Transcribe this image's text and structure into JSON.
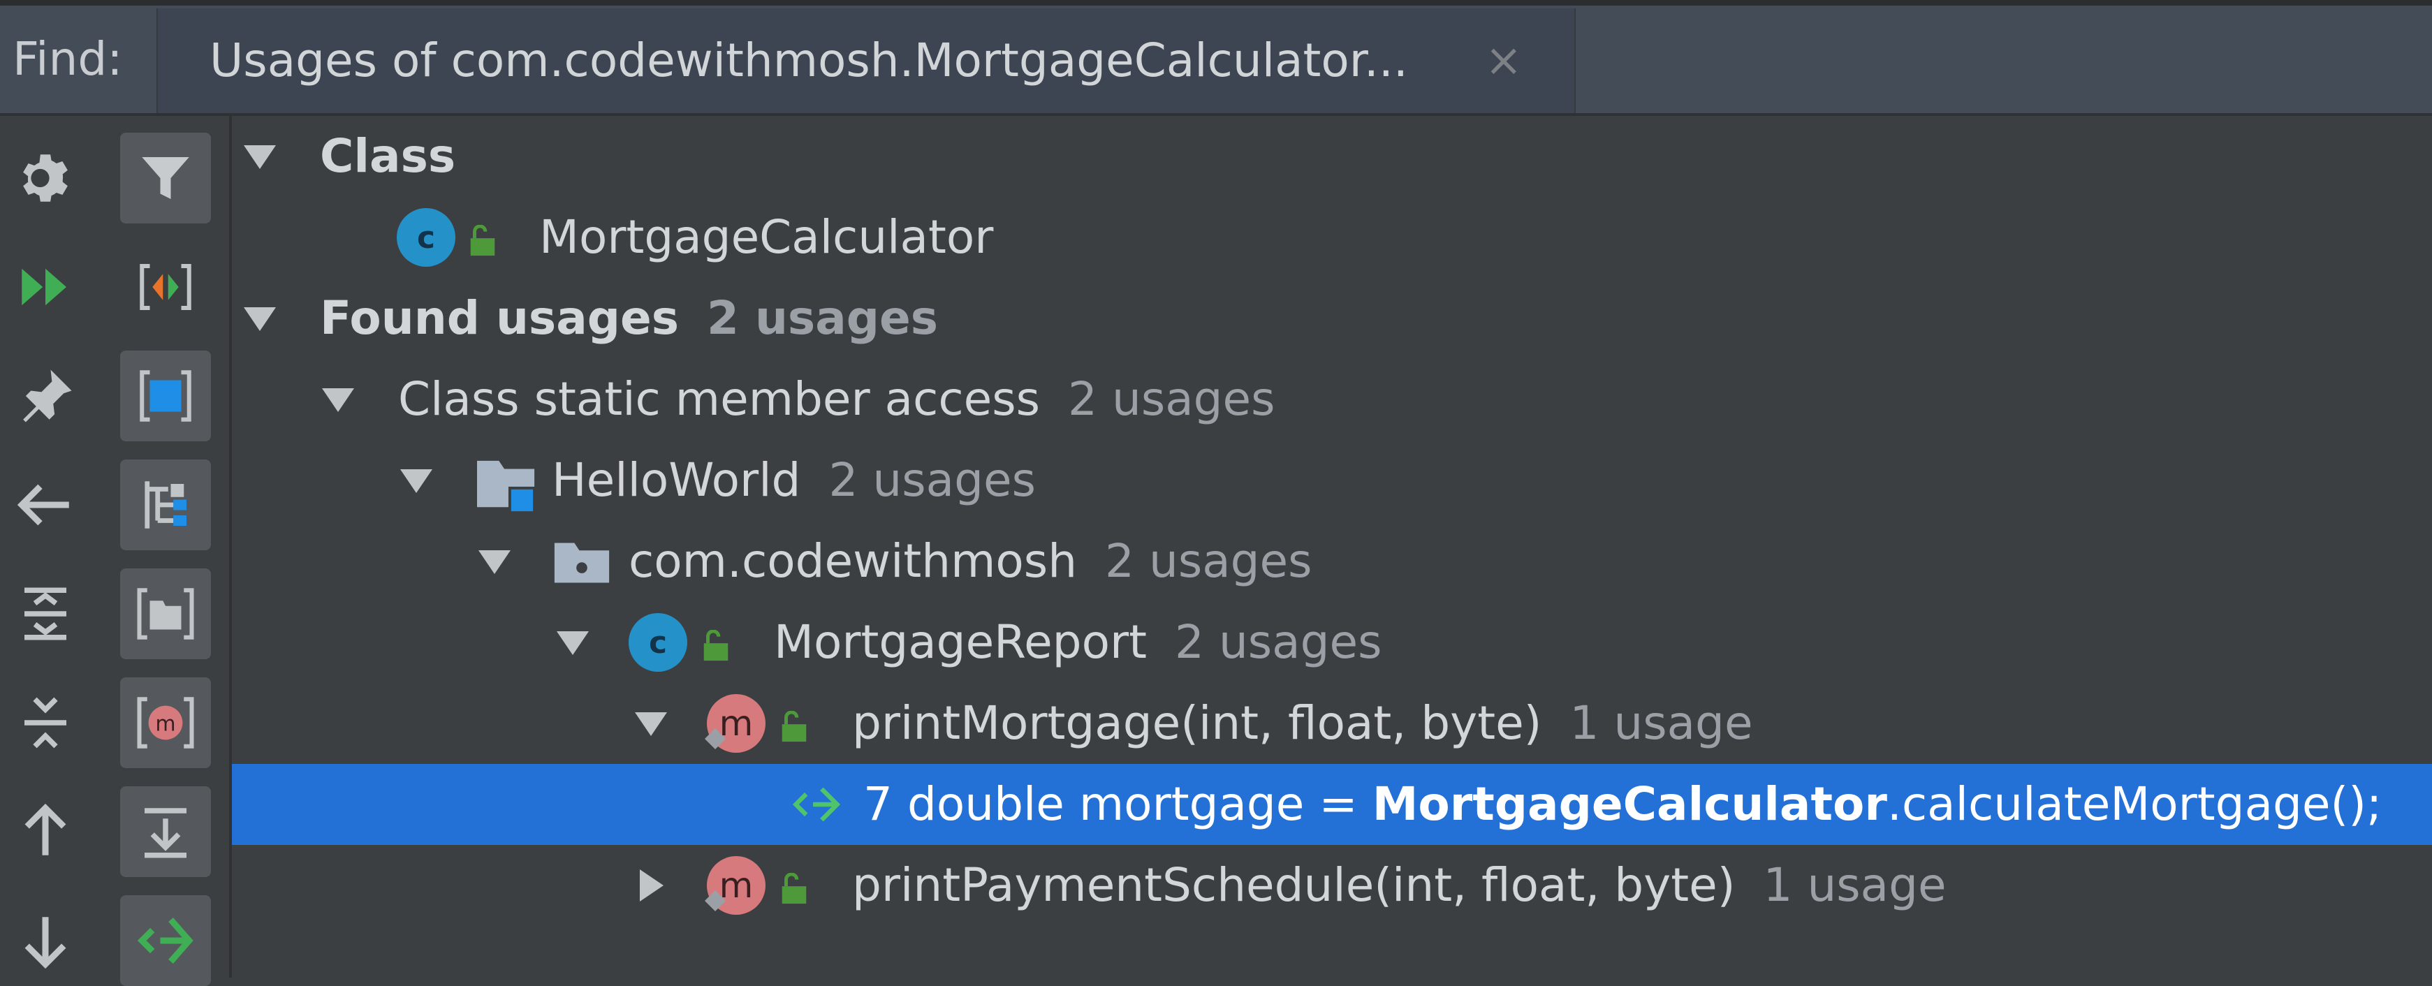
{
  "find_panel": {
    "find_label": "Find:",
    "tab_title": "Usages of com.codewithmosh.MortgageCalculator...",
    "tab_close_glyph": "×"
  },
  "toolbar": {
    "left_column": [
      "gear-icon",
      "rerun-icon",
      "pin-icon",
      "previous-occurrence-icon",
      "expand-all-icon",
      "collapse-all-icon",
      "next-icon",
      "down-icon"
    ],
    "right_column": [
      "filter-icon",
      "preview-icon",
      "module-group-icon",
      "package-group-icon",
      "directory-structure-icon",
      "method-group-icon",
      "merge-usages-icon",
      "navigate-icon"
    ]
  },
  "tree": {
    "class_header": {
      "label": "Class"
    },
    "class_node": {
      "label": "MortgageCalculator"
    },
    "found_usages": {
      "label": "Found usages",
      "count": "2 usages"
    },
    "static_access": {
      "label": "Class static member access",
      "count": "2 usages"
    },
    "module_node": {
      "label": "HelloWorld",
      "count": "2 usages"
    },
    "package_node": {
      "label": "com.codewithmosh",
      "count": "2 usages"
    },
    "class_report": {
      "label": "MortgageReport",
      "count": "2 usages"
    },
    "method_print_mortgage": {
      "label": "printMortgage(int, float, byte)",
      "count": "1 usage"
    },
    "usage_line": {
      "prefix": "7 double mortgage = ",
      "highlight": "MortgageCalculator",
      "suffix": ".calculateMortgage();"
    },
    "method_print_schedule": {
      "label": "printPaymentSchedule(int, float, byte)",
      "count": "1 usage"
    },
    "class_icon_letter": "c",
    "method_icon_letter": "m"
  },
  "colors": {
    "background": "#3c3f41",
    "selection": "#2370d6",
    "class_icon": "#2591c9",
    "method_icon": "#d77a7e",
    "lock_green": "#4e9a3a"
  }
}
